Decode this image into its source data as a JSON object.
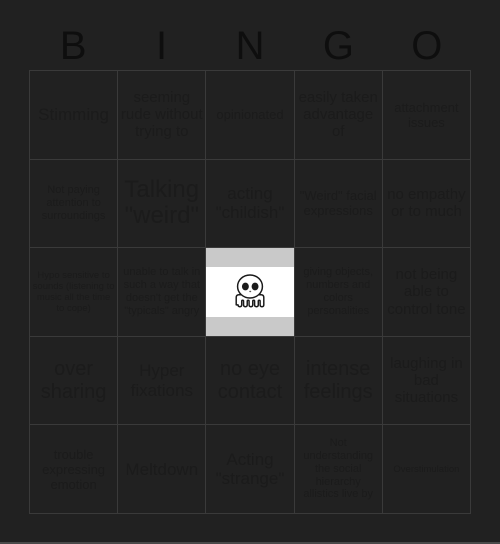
{
  "card": {
    "title": "BINGO",
    "header_letters": [
      "B",
      "I",
      "N",
      "G",
      "O"
    ],
    "background_color": "#212121",
    "text_color": "#1b1b1b",
    "grid_line_color": "#3a3a3a",
    "free_space_bg_color": "#c9c9c9",
    "free_space_inner_color": "#ffffff"
  },
  "grid": {
    "columns": 5,
    "rows": 5,
    "cells": [
      {
        "id": "b1",
        "column": "B",
        "row": 1,
        "text": "Stimming",
        "size": "l",
        "type": "text"
      },
      {
        "id": "i1",
        "column": "I",
        "row": 1,
        "text": "seeming rude without trying to",
        "size": "m",
        "type": "text"
      },
      {
        "id": "n1",
        "column": "N",
        "row": 1,
        "text": "opinionated",
        "size": "s",
        "type": "text"
      },
      {
        "id": "g1",
        "column": "G",
        "row": 1,
        "text": "easily taken advantage of",
        "size": "m",
        "type": "text"
      },
      {
        "id": "o1",
        "column": "O",
        "row": 1,
        "text": "attachment issues",
        "size": "s",
        "type": "text"
      },
      {
        "id": "b2",
        "column": "B",
        "row": 2,
        "text": "Not paying attention to surroundings",
        "size": "xs",
        "type": "text"
      },
      {
        "id": "i2",
        "column": "I",
        "row": 2,
        "text": "Talking \"weird\"",
        "size": "xxl",
        "type": "text"
      },
      {
        "id": "n2",
        "column": "N",
        "row": 2,
        "text": "acting \"childish\"",
        "size": "l",
        "type": "text"
      },
      {
        "id": "g2",
        "column": "G",
        "row": 2,
        "text": "\"Weird\" facial expressions",
        "size": "s",
        "type": "text"
      },
      {
        "id": "o2",
        "column": "O",
        "row": 2,
        "text": "no empathy or to much",
        "size": "m",
        "type": "text"
      },
      {
        "id": "b3",
        "column": "B",
        "row": 3,
        "text": "Hypo sensitive to sounds (listening to music all the time to cope)",
        "size": "xxs",
        "type": "text"
      },
      {
        "id": "i3",
        "column": "I",
        "row": 3,
        "text": "unable to talk in such a way that doesn't get the \"typicals\" angry",
        "size": "xs",
        "type": "text"
      },
      {
        "id": "n3",
        "column": "N",
        "row": 3,
        "text": "",
        "size": "s",
        "type": "image",
        "image_name": "tbh-creature"
      },
      {
        "id": "g3",
        "column": "G",
        "row": 3,
        "text": "giving objects, numbers and colors personalities",
        "size": "xs",
        "type": "text"
      },
      {
        "id": "o3",
        "column": "O",
        "row": 3,
        "text": "not being able to control tone",
        "size": "m",
        "type": "text"
      },
      {
        "id": "b4",
        "column": "B",
        "row": 4,
        "text": "over sharing",
        "size": "xl",
        "type": "text"
      },
      {
        "id": "i4",
        "column": "I",
        "row": 4,
        "text": "Hyper fixations",
        "size": "l",
        "type": "text"
      },
      {
        "id": "n4",
        "column": "N",
        "row": 4,
        "text": "no eye contact",
        "size": "xl",
        "type": "text"
      },
      {
        "id": "g4",
        "column": "G",
        "row": 4,
        "text": "intense feelings",
        "size": "xl",
        "type": "text"
      },
      {
        "id": "o4",
        "column": "O",
        "row": 4,
        "text": "laughing in bad situations",
        "size": "m",
        "type": "text"
      },
      {
        "id": "b5",
        "column": "B",
        "row": 5,
        "text": "trouble expressing emotion",
        "size": "s",
        "type": "text"
      },
      {
        "id": "i5",
        "column": "I",
        "row": 5,
        "text": "Meltdown",
        "size": "l",
        "type": "text"
      },
      {
        "id": "n5",
        "column": "N",
        "row": 5,
        "text": "Acting \"strange\"",
        "size": "l",
        "type": "text"
      },
      {
        "id": "g5",
        "column": "G",
        "row": 5,
        "text": "Not understanding the social hierarchy allistics live by",
        "size": "xs",
        "type": "text"
      },
      {
        "id": "o5",
        "column": "O",
        "row": 5,
        "text": "Overstimulation",
        "size": "xxs",
        "type": "text"
      }
    ]
  }
}
